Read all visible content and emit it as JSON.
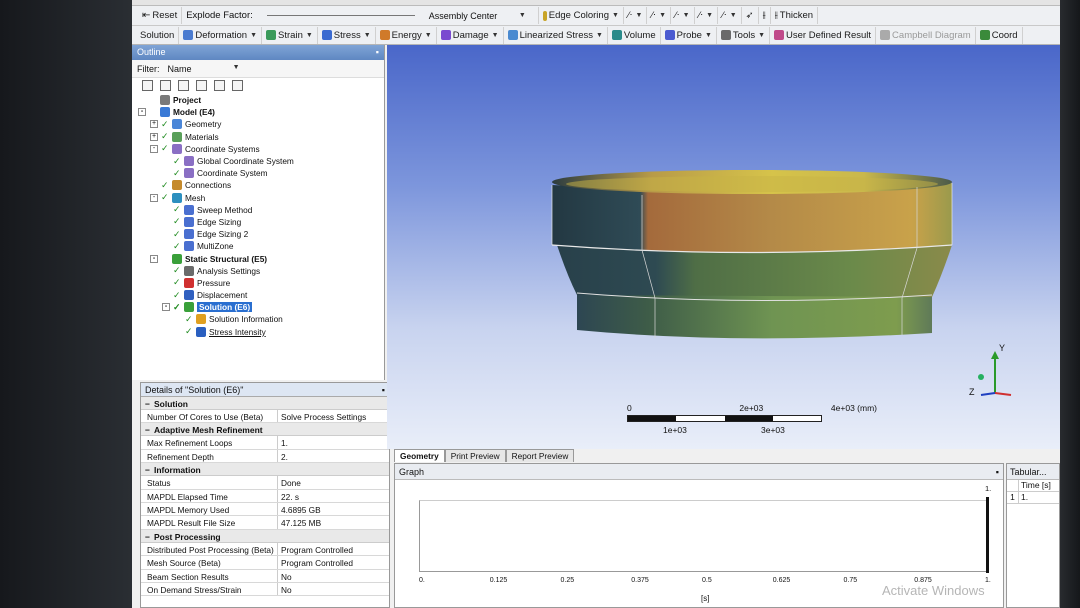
{
  "toolbar_context": {
    "reset_label": "Reset",
    "explode_label": "Explode Factor:",
    "assembly_center": "Assembly Center",
    "edge_coloring": "Edge Coloring",
    "thicken": "Thicken"
  },
  "toolbar_solution": {
    "items": [
      {
        "label": "Solution",
        "icon": "none",
        "dropdown": false
      },
      {
        "label": "Deformation",
        "icon": "deformation-icon",
        "dropdown": true
      },
      {
        "label": "Strain",
        "icon": "strain-icon",
        "dropdown": true
      },
      {
        "label": "Stress",
        "icon": "stress-icon",
        "dropdown": true
      },
      {
        "label": "Energy",
        "icon": "energy-icon",
        "dropdown": true
      },
      {
        "label": "Damage",
        "icon": "damage-icon",
        "dropdown": true
      },
      {
        "label": "Linearized Stress",
        "icon": "linearized-stress-icon",
        "dropdown": true
      },
      {
        "label": "Volume",
        "icon": "volume-icon",
        "dropdown": false
      },
      {
        "label": "Probe",
        "icon": "probe-icon",
        "dropdown": true
      },
      {
        "label": "Tools",
        "icon": "tools-icon",
        "dropdown": true
      },
      {
        "label": "User Defined Result",
        "icon": "user-defined-result-icon",
        "dropdown": false
      },
      {
        "label": "Campbell Diagram",
        "icon": "campbell-icon",
        "dropdown": false,
        "disabled": true
      },
      {
        "label": "Coord",
        "icon": "coord-icon",
        "dropdown": false
      }
    ]
  },
  "outline": {
    "title": "Outline",
    "pin": "▪",
    "filter_label": "Filter:",
    "filter_value": "Name",
    "tree": [
      {
        "label": "Project",
        "level": 0,
        "bold": true,
        "exp": "",
        "check": false,
        "color": "#7a7a7a"
      },
      {
        "label": "Model (E4)",
        "level": 0,
        "bold": true,
        "exp": "-",
        "check": false,
        "color": "#3a7ad6"
      },
      {
        "label": "Geometry",
        "level": 1,
        "exp": "+",
        "check": true,
        "color": "#4a86d8"
      },
      {
        "label": "Materials",
        "level": 1,
        "exp": "+",
        "check": true,
        "color": "#5aa05a"
      },
      {
        "label": "Coordinate Systems",
        "level": 1,
        "exp": "-",
        "check": true,
        "color": "#8a6fc4"
      },
      {
        "label": "Global Coordinate System",
        "level": 2,
        "exp": "",
        "check": true,
        "color": "#8a6fc4"
      },
      {
        "label": "Coordinate System",
        "level": 2,
        "exp": "",
        "check": true,
        "color": "#8a6fc4"
      },
      {
        "label": "Connections",
        "level": 1,
        "exp": "",
        "check": true,
        "color": "#c58a2c"
      },
      {
        "label": "Mesh",
        "level": 1,
        "exp": "-",
        "check": true,
        "color": "#2c8fbf"
      },
      {
        "label": "Sweep Method",
        "level": 2,
        "exp": "",
        "check": true,
        "color": "#4a6fd0"
      },
      {
        "label": "Edge Sizing",
        "level": 2,
        "exp": "",
        "check": true,
        "color": "#4a6fd0"
      },
      {
        "label": "Edge Sizing 2",
        "level": 2,
        "exp": "",
        "check": true,
        "color": "#4a6fd0"
      },
      {
        "label": "MultiZone",
        "level": 2,
        "exp": "",
        "check": true,
        "color": "#4a6fd0"
      },
      {
        "label": "Static Structural (E5)",
        "level": 1,
        "bold": true,
        "exp": "-",
        "check": false,
        "color": "#3aa03a"
      },
      {
        "label": "Analysis Settings",
        "level": 2,
        "exp": "",
        "check": true,
        "color": "#6a6a6a"
      },
      {
        "label": "Pressure",
        "level": 2,
        "exp": "",
        "check": true,
        "color": "#d03030"
      },
      {
        "label": "Displacement",
        "level": 2,
        "exp": "",
        "check": true,
        "color": "#3060c0"
      },
      {
        "label": "Solution (E6)",
        "level": 2,
        "bold": true,
        "selected": true,
        "exp": "-",
        "check": true,
        "color": "#3aa03a"
      },
      {
        "label": "Solution Information",
        "level": 3,
        "exp": "",
        "check": true,
        "color": "#e0a020"
      },
      {
        "label": "Stress Intensity",
        "level": 3,
        "exp": "",
        "check": true,
        "link": true,
        "color": "#2a5fc0"
      }
    ]
  },
  "details": {
    "title": "Details of \"Solution (E6)\"",
    "pin": "▪",
    "groups": [
      {
        "name": "Solution",
        "rows": [
          {
            "k": "Number Of Cores to Use (Beta)",
            "v": "Solve Process Settings"
          }
        ]
      },
      {
        "name": "Adaptive Mesh Refinement",
        "rows": [
          {
            "k": "Max Refinement Loops",
            "v": "1."
          },
          {
            "k": "Refinement Depth",
            "v": "2."
          }
        ]
      },
      {
        "name": "Information",
        "rows": [
          {
            "k": "Status",
            "v": "Done"
          },
          {
            "k": "MAPDL Elapsed Time",
            "v": "22. s"
          },
          {
            "k": "MAPDL Memory Used",
            "v": "4.6895 GB"
          },
          {
            "k": "MAPDL Result File Size",
            "v": "47.125 MB"
          }
        ]
      },
      {
        "name": "Post Processing",
        "rows": [
          {
            "k": "Distributed Post Processing (Beta)",
            "v": "Program Controlled"
          },
          {
            "k": "Mesh Source (Beta)",
            "v": "Program Controlled"
          },
          {
            "k": "Beam Section Results",
            "v": "No"
          },
          {
            "k": "On Demand Stress/Strain",
            "v": "No"
          }
        ]
      }
    ]
  },
  "viewport": {
    "scale_ticks_top": [
      "0",
      "2e+03",
      "4e+03 (mm)"
    ],
    "scale_ticks_bottom": [
      "1e+03",
      "3e+03"
    ],
    "axis_y": "Y",
    "axis_z": "Z"
  },
  "tabs": [
    "Geometry",
    "Print Preview",
    "Report Preview"
  ],
  "graph": {
    "title": "Graph",
    "pin": "▪",
    "y_top": "1.",
    "x_ticks": [
      "0.",
      "0.125",
      "0.25",
      "0.375",
      "0.5",
      "0.625",
      "0.75",
      "0.875",
      "1."
    ],
    "x_unit": "[s]"
  },
  "tabular": {
    "title": "Tabular...",
    "header": "Time [s]",
    "row_index": "1",
    "row_value": "1."
  },
  "watermark": "Activate Windows"
}
